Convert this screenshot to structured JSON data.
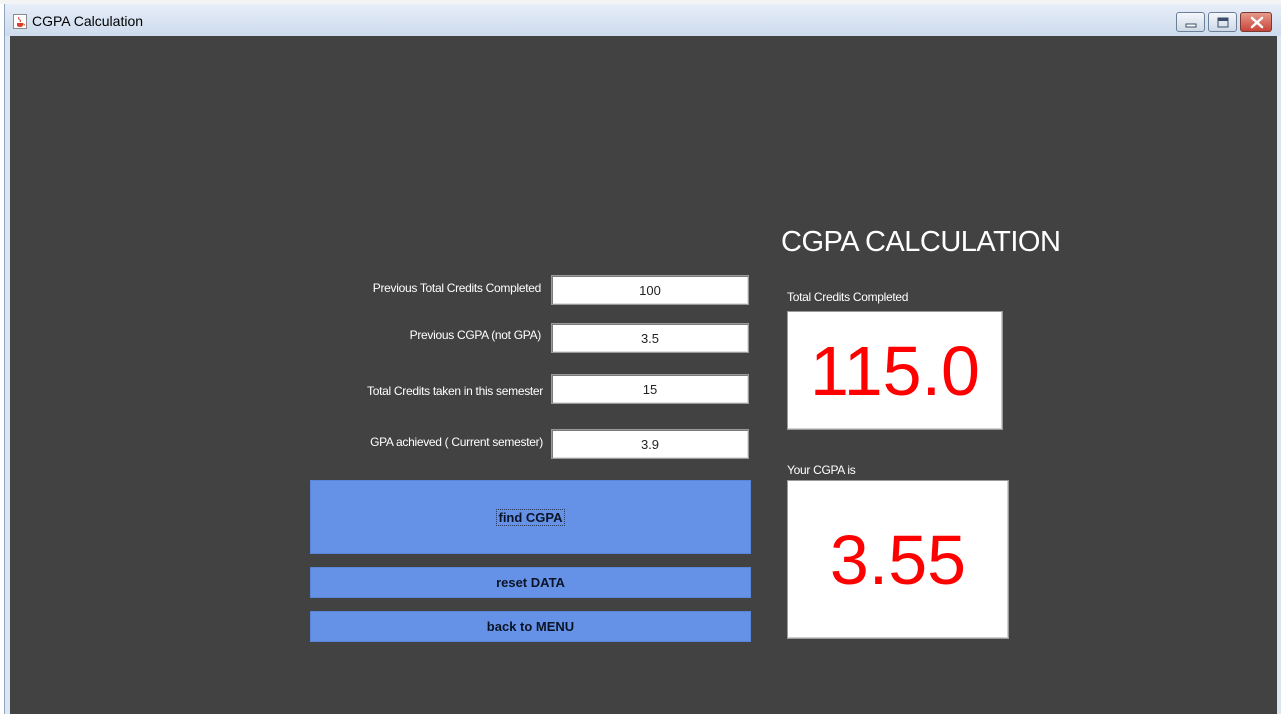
{
  "window": {
    "title": "CGPA Calculation"
  },
  "main": {
    "heading": "CGPA CALCULATION",
    "fields": [
      {
        "label": "Previous Total Credits Completed",
        "value": "100"
      },
      {
        "label": "Previous CGPA (not GPA)",
        "value": "3.5"
      },
      {
        "label": "Total Credits  taken in this semester",
        "value": "15"
      },
      {
        "label": "GPA achieved ( Current semester)",
        "value": "3.9"
      }
    ],
    "buttons": {
      "find": "find CGPA",
      "reset": "reset DATA",
      "back": "back to MENU"
    },
    "results": {
      "credits_label": "Total Credits Completed",
      "credits_value": "115.0",
      "cgpa_label": "Your CGPA is",
      "cgpa_value": "3.55"
    }
  },
  "colors": {
    "background": "#424242",
    "button": "#6592e6",
    "result_text": "#ff0000"
  }
}
